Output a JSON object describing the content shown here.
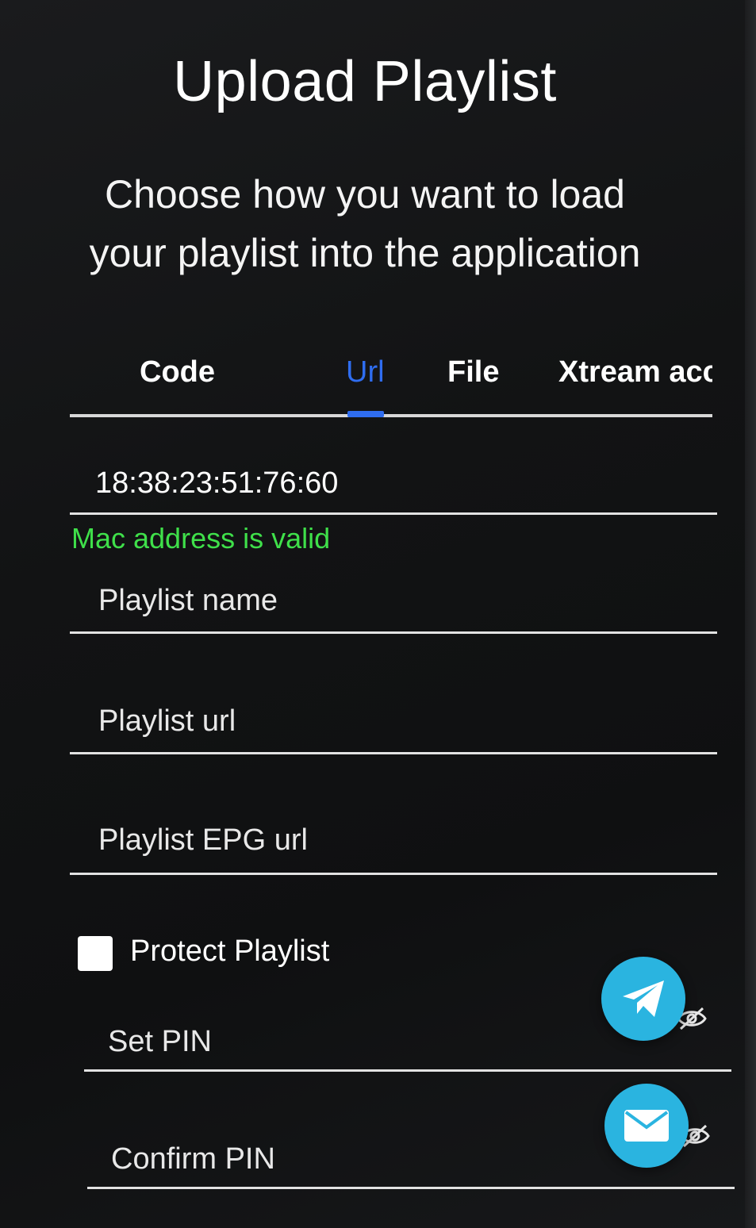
{
  "page": {
    "title": "Upload Playlist",
    "subtitle": "Choose how you want to load your playlist into the application"
  },
  "tabs": {
    "items": [
      {
        "label": "Code"
      },
      {
        "label": "Url"
      },
      {
        "label": "File"
      },
      {
        "label": "Xtream acc"
      }
    ],
    "active": "Url",
    "active_color": "#2f6df0"
  },
  "form": {
    "mac_address": {
      "value": "18:38:23:51:76:60"
    },
    "mac_status": {
      "text": "Mac address is valid",
      "color": "#3fe04a"
    },
    "playlist_name": {
      "placeholder": "Playlist name"
    },
    "playlist_url": {
      "placeholder": "Playlist url"
    },
    "playlist_epg_url": {
      "placeholder": "Playlist EPG url"
    },
    "protect_playlist": {
      "label": "Protect Playlist",
      "checked": false
    },
    "set_pin": {
      "placeholder": "Set PIN",
      "toggle_icon": "eye-off-icon"
    },
    "confirm_pin": {
      "placeholder": "Confirm PIN",
      "toggle_icon": "eye-off-icon"
    }
  },
  "floating_buttons": {
    "telegram": {
      "icon": "telegram-icon",
      "color": "#2ab4e0"
    },
    "email": {
      "icon": "mail-icon",
      "color": "#2ab4e0"
    }
  }
}
